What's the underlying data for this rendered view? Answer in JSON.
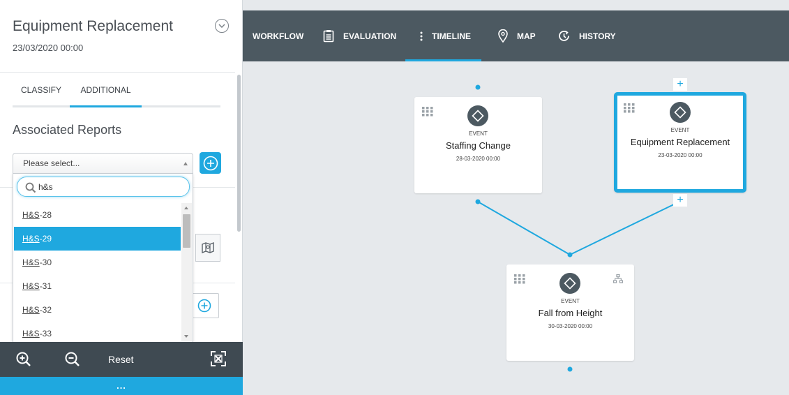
{
  "left_panel": {
    "title": "Equipment Replacement",
    "date": "23/03/2020 00:00",
    "tabs": [
      {
        "label": "CLASSIFY"
      },
      {
        "label": "ADDITIONAL",
        "active": true
      }
    ],
    "section_title": "Associated Reports",
    "select": {
      "value": "Please select...",
      "search_value": "h&s",
      "options": [
        {
          "prefix": "H&S",
          "suffix": "-28"
        },
        {
          "prefix": "H&S",
          "suffix": "-29",
          "selected": true
        },
        {
          "prefix": "H&S",
          "suffix": "-30"
        },
        {
          "prefix": "H&S",
          "suffix": "-31"
        },
        {
          "prefix": "H&S",
          "suffix": "-32"
        },
        {
          "prefix": "H&S",
          "suffix": "-33"
        }
      ]
    }
  },
  "toolbar": {
    "zoom_in_icon": "zoom-in-icon",
    "zoom_out_icon": "zoom-out-icon",
    "reset_label": "Reset",
    "fit_icon": "fit-screen-icon",
    "more_label": "..."
  },
  "nav": {
    "items": [
      {
        "label": "WORKFLOW",
        "icon": ""
      },
      {
        "label": "EVALUATION",
        "icon": "clipboard-icon"
      },
      {
        "label": "TIMELINE",
        "icon": "vertical-dots-icon",
        "active": true
      },
      {
        "label": "MAP",
        "icon": "map-pin-icon"
      },
      {
        "label": "HISTORY",
        "icon": "history-icon"
      }
    ]
  },
  "timeline": {
    "nodes": [
      {
        "type": "EVENT",
        "title": "Staffing Change",
        "date": "28-03-2020 00:00"
      },
      {
        "type": "EVENT",
        "title": "Equipment Replacement",
        "date": "23-03-2020 00:00",
        "selected": true
      },
      {
        "type": "EVENT",
        "title": "Fall from Height",
        "date": "30-03-2020 00:00"
      }
    ],
    "plus_label": "+"
  },
  "colors": {
    "accent": "#1fa8df",
    "nav_bg": "#4c5961",
    "toolbar_bg": "#3f4a52",
    "canvas_bg": "#e6e9ec"
  }
}
